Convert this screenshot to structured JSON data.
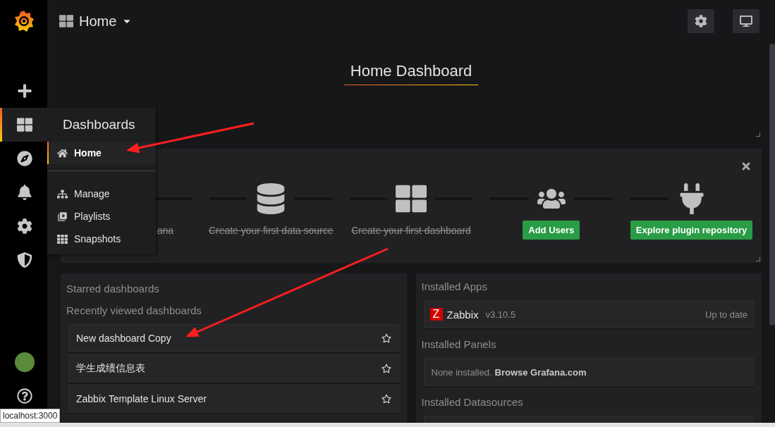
{
  "topbar": {
    "dashboard_picker": "Home"
  },
  "sidebar": {
    "items": [
      {
        "kind": "create",
        "selected": false
      },
      {
        "kind": "dashboards",
        "selected": true
      },
      {
        "kind": "explore",
        "selected": false
      },
      {
        "kind": "alerting",
        "selected": false
      },
      {
        "kind": "configuration",
        "selected": false
      },
      {
        "kind": "admin",
        "selected": false
      }
    ]
  },
  "dashboards_menu": {
    "title": "Dashboards",
    "items": [
      {
        "kind": "home",
        "label": "Home",
        "selected": true
      },
      {
        "kind": "manage",
        "label": "Manage",
        "selected": false
      },
      {
        "kind": "playlists",
        "label": "Playlists",
        "selected": false
      },
      {
        "kind": "snapshots",
        "label": "Snapshots",
        "selected": false
      }
    ]
  },
  "dashboard_title": "Home Dashboard",
  "getting_started": {
    "steps": [
      {
        "kind": "done",
        "label": "ana"
      },
      {
        "kind": "done",
        "label": "Create your first data source"
      },
      {
        "kind": "done",
        "label": "Create your first dashboard"
      },
      {
        "kind": "action",
        "label": "Add Users"
      },
      {
        "kind": "action",
        "label": "Explore plugin repository"
      }
    ]
  },
  "starred": {
    "title": "Starred dashboards"
  },
  "recent": {
    "title": "Recently viewed dashboards",
    "items": [
      {
        "label": "New dashboard Copy",
        "starred": false
      },
      {
        "label": "学生成绩信息表",
        "starred": false
      },
      {
        "label": "Zabbix Template Linux Server",
        "starred": false
      }
    ]
  },
  "installed_apps": {
    "title": "Installed Apps",
    "items": [
      {
        "logo_letter": "Z",
        "name": "Zabbix",
        "version": "v3.10.5",
        "status": "Up to date"
      }
    ]
  },
  "installed_panels": {
    "title": "Installed Panels",
    "empty_text": "None installed.",
    "link": "Browse Grafana.com"
  },
  "installed_datasources": {
    "title": "Installed Datasources"
  },
  "status_tooltip": "localhost:3000"
}
